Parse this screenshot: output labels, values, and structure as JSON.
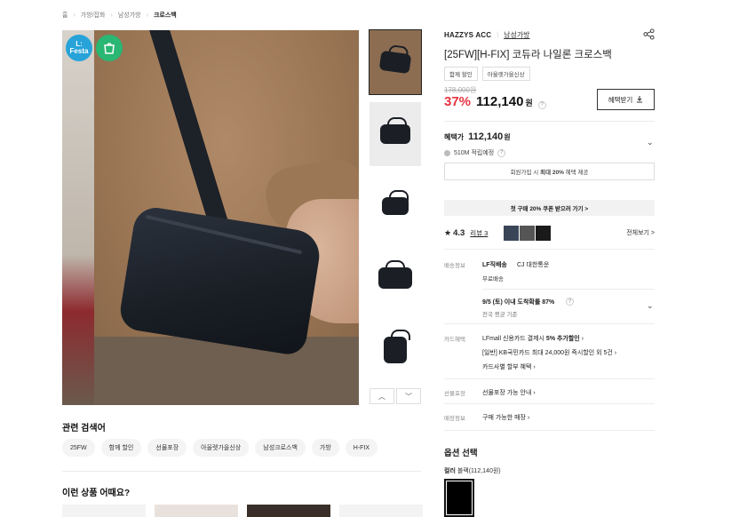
{
  "breadcrumb": [
    "홈",
    "가방/잡화",
    "남성가방",
    "크로스백"
  ],
  "gallery": {
    "badge_festa_line1": "L:",
    "badge_festa_line2": "Festa",
    "badge_festa_color": "#27a3d9",
    "badge_shop_color": "#2ab673",
    "thumbnail_count": 5,
    "nav_up": "︿",
    "nav_down": "﹀"
  },
  "related": {
    "title": "관련 검색어",
    "chips": [
      "25FW",
      "함께 할인",
      "선물포장",
      "아울렛가을신상",
      "남성크로스백",
      "가방",
      "H-FIX"
    ]
  },
  "recommend": {
    "title": "이런 상품 어때요?"
  },
  "product": {
    "brand": "HAZZYS ACC",
    "category": "남성가방",
    "name": "[25FW][H-FIX] 코듀라 나일론 크로스백",
    "tags": [
      "함께 할인",
      "아울렛가을신상"
    ],
    "original_price": "178,000원",
    "discount": "37%",
    "price": "112,140",
    "won": "원",
    "coupon_button": "혜택받기",
    "benefit_label": "혜택가",
    "benefit_price": "112,140",
    "benefit_won": "원",
    "points": "510M 적립예정",
    "join_text_pre": "회원가입 시 ",
    "join_text_bold": "최대 20%",
    "join_text_post": " 혜택 제공",
    "first_buy": "첫 구매 20% 쿠폰 받으러 가기 >",
    "rating": "4.3",
    "review_link": "리뷰 3",
    "review_all": "전체보기 >"
  },
  "shipping": {
    "label": "배송정보",
    "method": "LF직배송",
    "carrier": "CJ 대한통운",
    "fee": "무료배송",
    "arrival": "9/5 (토) 이내 도착확률 87%",
    "arrival_sub": "전국 평균 기준"
  },
  "card": {
    "label": "카드혜택",
    "line1_pre": "LFmall 신용카드 결제시 ",
    "line1_bold": "5% 추가할인",
    "line2": "[일반] KB국민카드 최대 24,000원 즉시할인 외 5건",
    "line3": "카드사별 할부 혜택"
  },
  "gift": {
    "label": "선물포장",
    "value": "선물포장 가능 안내"
  },
  "store": {
    "label": "매장정보",
    "value": "구매 가능한 매장"
  },
  "options": {
    "title": "옵션 선택",
    "color_label": "컬러",
    "color_value": "블랙(112,140원)"
  },
  "colors": {
    "accent_red": "#e8333f"
  }
}
